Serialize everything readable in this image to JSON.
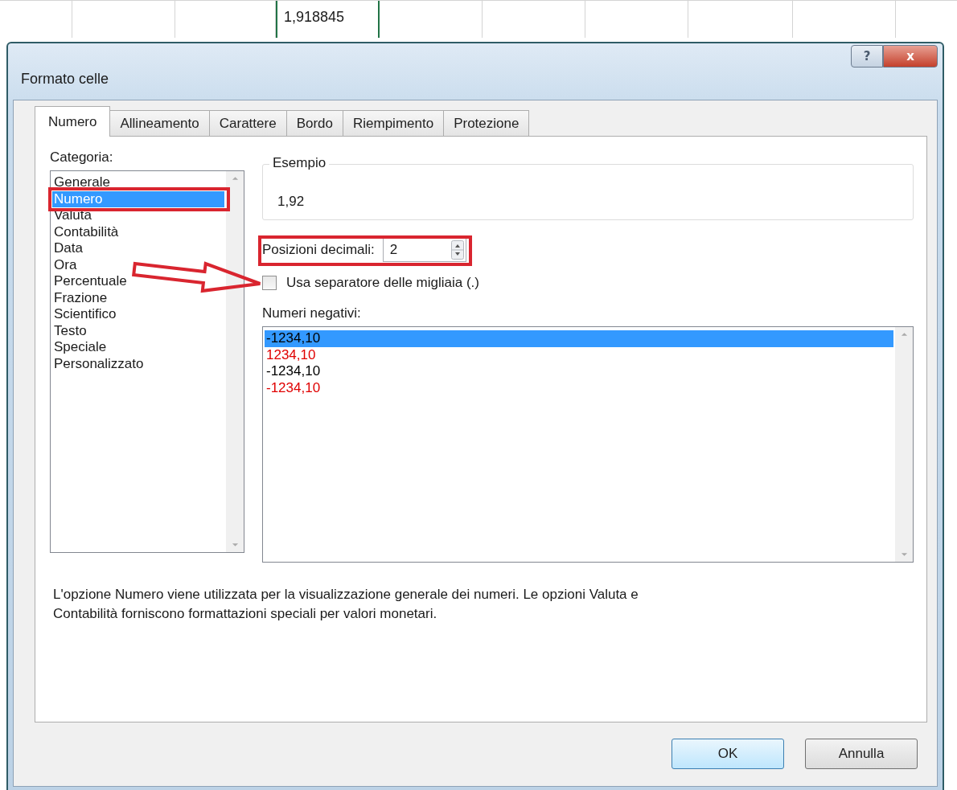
{
  "sheet": {
    "cells": [
      {
        "active": false
      },
      {
        "active": false
      },
      {
        "active": false
      },
      {
        "active": true,
        "value": "1,918845"
      },
      {
        "active": false
      },
      {
        "active": false
      },
      {
        "active": false
      },
      {
        "active": false
      },
      {
        "active": false
      }
    ]
  },
  "window": {
    "title": "Formato celle",
    "help": "?",
    "close": "x"
  },
  "tabs": [
    {
      "label": "Numero",
      "selected": true
    },
    {
      "label": "Allineamento",
      "selected": false
    },
    {
      "label": "Carattere",
      "selected": false
    },
    {
      "label": "Bordo",
      "selected": false
    },
    {
      "label": "Riempimento",
      "selected": false
    },
    {
      "label": "Protezione",
      "selected": false
    }
  ],
  "category": {
    "label": "Categoria:",
    "items": [
      {
        "label": "Generale",
        "selected": false,
        "highlighted": false
      },
      {
        "label": "Numero",
        "selected": true,
        "highlighted": true
      },
      {
        "label": "Valuta",
        "selected": false,
        "highlighted": false
      },
      {
        "label": "Contabilità",
        "selected": false,
        "highlighted": false
      },
      {
        "label": "Data",
        "selected": false,
        "highlighted": false
      },
      {
        "label": "Ora",
        "selected": false,
        "highlighted": false
      },
      {
        "label": "Percentuale",
        "selected": false,
        "highlighted": false
      },
      {
        "label": "Frazione",
        "selected": false,
        "highlighted": false
      },
      {
        "label": "Scientifico",
        "selected": false,
        "highlighted": false
      },
      {
        "label": "Testo",
        "selected": false,
        "highlighted": false
      },
      {
        "label": "Speciale",
        "selected": false,
        "highlighted": false
      },
      {
        "label": "Personalizzato",
        "selected": false,
        "highlighted": false
      }
    ]
  },
  "sample": {
    "label": "Esempio",
    "value": "1,92"
  },
  "decimal_places": {
    "label": "Posizioni decimali:",
    "value": "2",
    "highlighted": true
  },
  "thousands_separator": {
    "label": "Usa separatore delle migliaia (.)",
    "checked": false,
    "pointed": true
  },
  "negative_numbers": {
    "label": "Numeri negativi:",
    "items": [
      {
        "label": "-1234,10",
        "color": "#000000",
        "selected": true
      },
      {
        "label": "1234,10",
        "color": "#e00000",
        "selected": false
      },
      {
        "label": "-1234,10",
        "color": "#000000",
        "selected": false
      },
      {
        "label": "-1234,10",
        "color": "#e00000",
        "selected": false
      }
    ]
  },
  "description": "L'opzione Numero viene utilizzata per la visualizzazione generale dei numeri. Le opzioni Valuta e Contabilità forniscono formattazioni speciali per valori monetari.",
  "buttons": [
    {
      "label": "OK",
      "default": true
    },
    {
      "label": "Annulla",
      "default": false
    }
  ]
}
